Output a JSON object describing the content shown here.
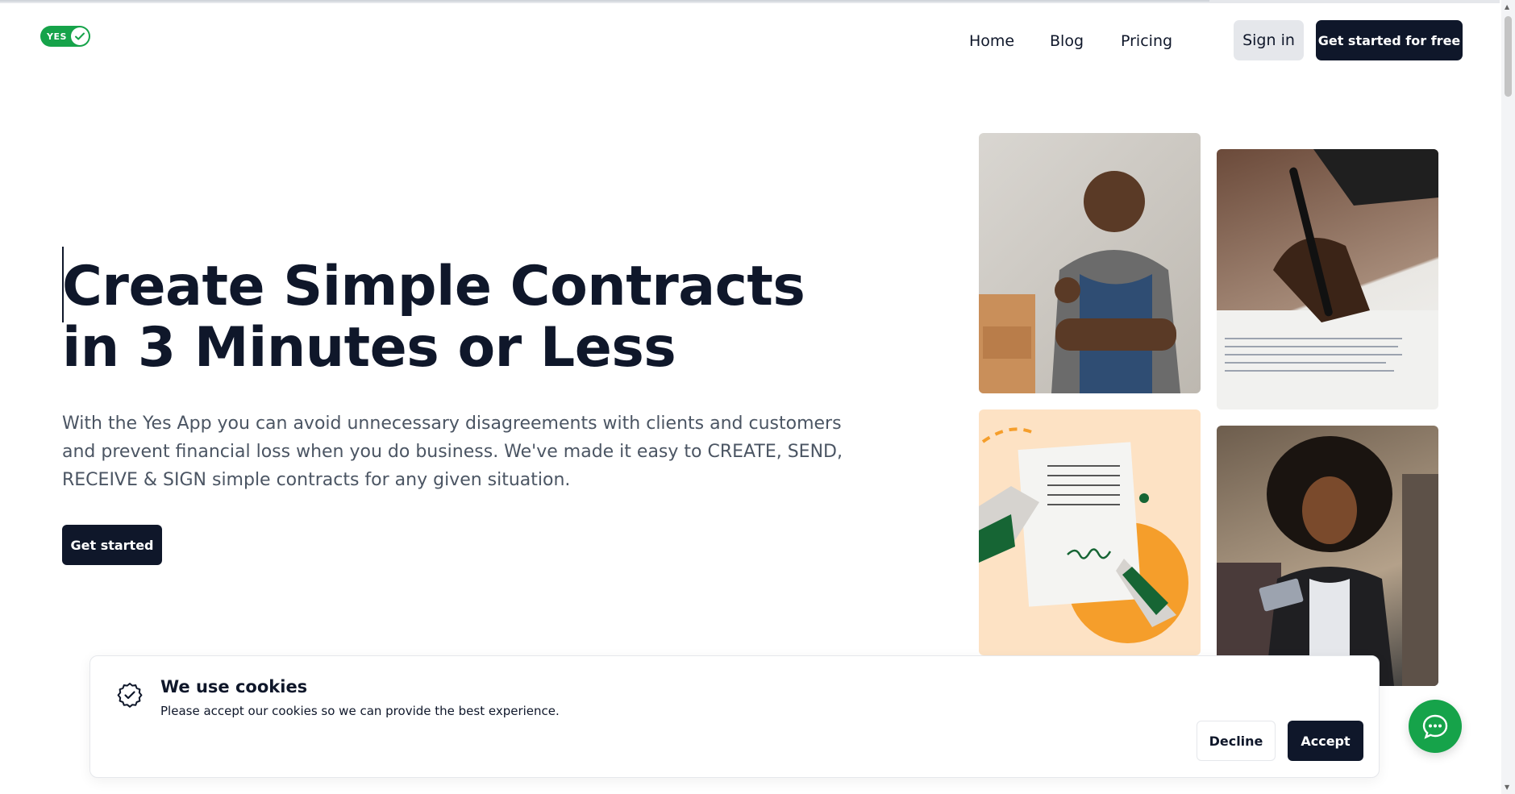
{
  "header": {
    "logo_text": "YES",
    "nav": [
      "Home",
      "Blog",
      "Pricing"
    ],
    "sign_in_label": "Sign in",
    "cta_label": "Get started for free"
  },
  "hero": {
    "title": "Create Simple Contracts in 3 Minutes or Less",
    "subtitle": "With the Yes App you can avoid unnecessary disagreements with clients and customers and prevent financial loss when you do business. We've made it easy to CREATE, SEND, RECEIVE & SIGN simple contracts for any given situation.",
    "cta_label": "Get started"
  },
  "images": [
    {
      "icon": "smiling-shopkeeper-photo"
    },
    {
      "icon": "hand-signing-document-photo"
    },
    {
      "icon": "contract-signature-illustration"
    },
    {
      "icon": "woman-with-tablet-photo"
    }
  ],
  "cookie_banner": {
    "title": "We use cookies",
    "text": "Please accept our cookies so we can provide the best experience.",
    "decline_label": "Decline",
    "accept_label": "Accept"
  },
  "colors": {
    "brand_green": "#16a34a",
    "dark": "#0f172a"
  }
}
